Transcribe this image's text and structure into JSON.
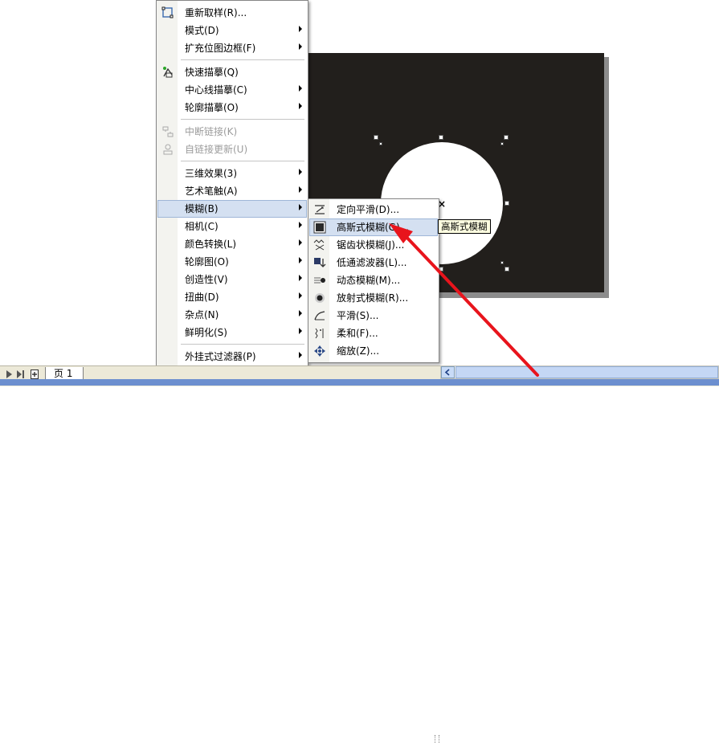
{
  "main_menu": {
    "items": [
      {
        "label": "重新取样(R)...",
        "icon": "resample-icon",
        "arrow": false,
        "disabled": false
      },
      {
        "label": "模式(D)",
        "arrow": true,
        "disabled": false
      },
      {
        "label": "扩充位图边框(F)",
        "arrow": true,
        "disabled": false
      },
      {
        "label": "快速描摹(Q)",
        "icon": "quick-trace-icon",
        "arrow": false,
        "disabled": false
      },
      {
        "label": "中心线描摹(C)",
        "arrow": true,
        "disabled": false
      },
      {
        "label": "轮廓描摹(O)",
        "arrow": true,
        "disabled": false
      },
      {
        "label": "中断链接(K)",
        "icon": "break-link-icon",
        "arrow": false,
        "disabled": true
      },
      {
        "label": "自链接更新(U)",
        "icon": "update-link-icon",
        "arrow": false,
        "disabled": true
      },
      {
        "label": "三维效果(3)",
        "arrow": true,
        "disabled": false
      },
      {
        "label": "艺术笔触(A)",
        "arrow": true,
        "disabled": false
      },
      {
        "label": "模糊(B)",
        "arrow": true,
        "disabled": false,
        "highlight": true
      },
      {
        "label": "相机(C)",
        "arrow": true,
        "disabled": false
      },
      {
        "label": "颜色转换(L)",
        "arrow": true,
        "disabled": false
      },
      {
        "label": "轮廓图(O)",
        "arrow": true,
        "disabled": false
      },
      {
        "label": "创造性(V)",
        "arrow": true,
        "disabled": false
      },
      {
        "label": "扭曲(D)",
        "arrow": true,
        "disabled": false
      },
      {
        "label": "杂点(N)",
        "arrow": true,
        "disabled": false
      },
      {
        "label": "鲜明化(S)",
        "arrow": true,
        "disabled": false
      },
      {
        "label": "外挂式过滤器(P)",
        "arrow": true,
        "disabled": false
      }
    ]
  },
  "blur_submenu": {
    "items": [
      {
        "label": "定向平滑(D)...",
        "icon": "directional-smooth-icon"
      },
      {
        "label": "高斯式模糊(G)...",
        "icon": "gaussian-blur-icon",
        "highlight": true
      },
      {
        "label": "锯齿状模糊(J)...",
        "icon": "jaggy-despeckle-icon"
      },
      {
        "label": "低通滤波器(L)...",
        "icon": "low-pass-icon"
      },
      {
        "label": "动态模糊(M)...",
        "icon": "motion-blur-icon"
      },
      {
        "label": "放射式模糊(R)...",
        "icon": "radial-blur-icon"
      },
      {
        "label": "平滑(S)...",
        "icon": "smooth-icon"
      },
      {
        "label": "柔和(F)...",
        "icon": "soften-icon"
      },
      {
        "label": "缩放(Z)...",
        "icon": "zoom-blur-icon"
      }
    ]
  },
  "tooltip": {
    "text": "高斯式模糊"
  },
  "statusbar": {
    "page_tab": "页 1"
  },
  "colors": {
    "highlight": "#d4e0f1",
    "arrow": "#e8141c",
    "document": "#221f1c"
  }
}
